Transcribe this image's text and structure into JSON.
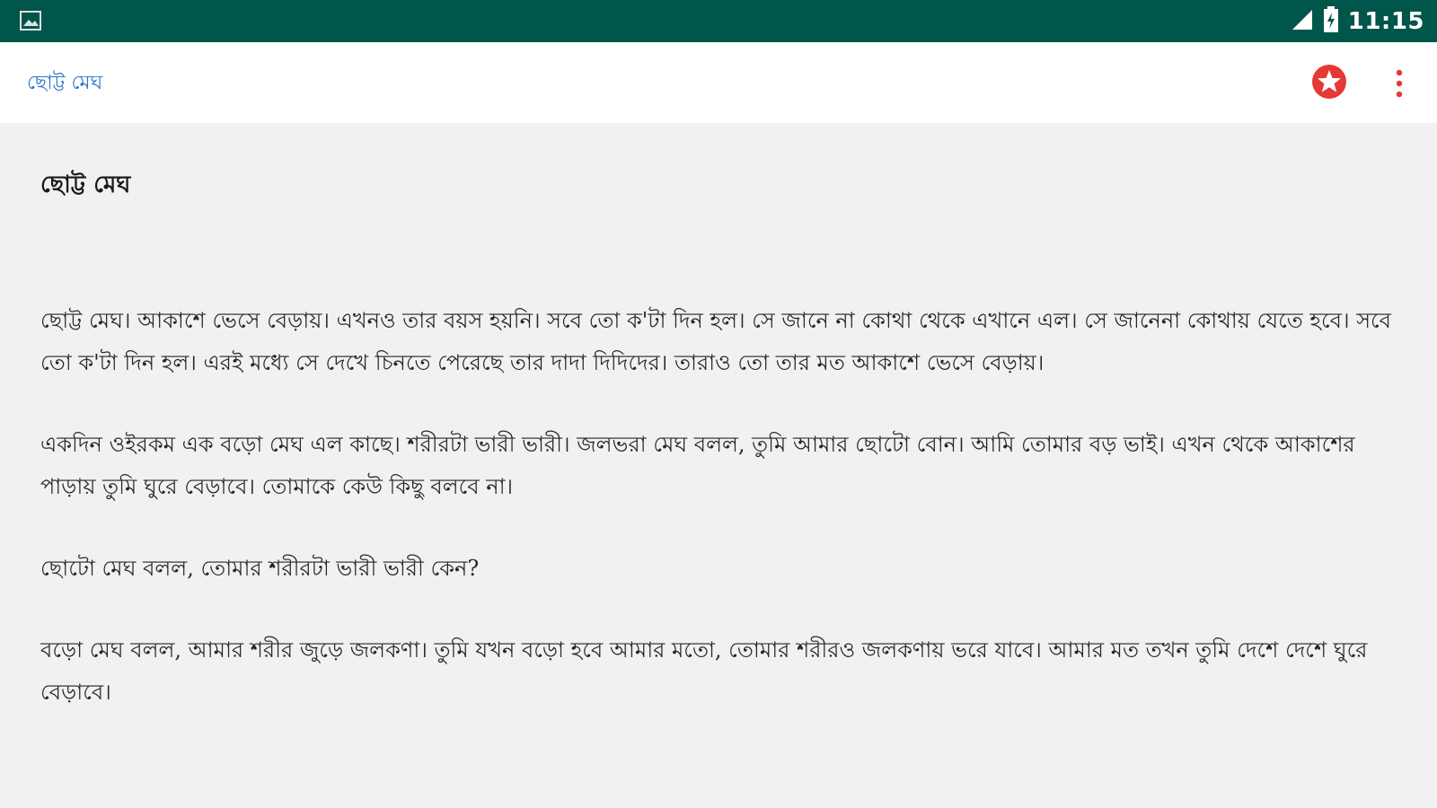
{
  "status_bar": {
    "time": "11:15",
    "icons": [
      "gallery-icon",
      "signal-icon",
      "battery-charging-icon"
    ]
  },
  "toolbar": {
    "title": "ছোট্ট মেঘ",
    "actions": [
      "favorite-star-icon",
      "more-vert-icon"
    ]
  },
  "article": {
    "heading": "ছোট্ট মেঘ",
    "paragraphs": [
      "ছোট্ট মেঘ। আকাশে ভেসে বেড়ায়। এখনও তার বয়স হয়নি। সবে তো ক'টা দিন হল। সে জানে না কোথা থেকে এখানে এল। সে জানেনা কোথায় যেতে হবে। সবে তো ক'টা দিন হল। এরই মধ্যে সে দেখে চিনতে পেরেছে তার দাদা দিদিদের। তারাও তো তার মত আকাশে ভেসে বেড়ায়।",
      "একদিন ওইরকম এক বড়ো মেঘ এল কাছে। শরীরটা ভারী ভারী। জলভরা মেঘ বলল, তুমি আমার ছোটো বোন। আমি তোমার বড় ভাই। এখন থেকে আকাশের পাড়ায় তুমি ঘুরে বেড়াবে। তোমাকে কেউ কিছু বলবে না।",
      "ছোটো মেঘ বলল, তোমার শরীরটা ভারী ভারী কেন?",
      "বড়ো মেঘ বলল, আমার শরীর জুড়ে জলকণা। তুমি যখন বড়ো হবে আমার মতো, তোমার শরীরও জলকণায় ভরে যাবে। আমার মত তখন তুমি দেশে দেশে ঘুরে বেড়াবে।"
    ]
  },
  "colors": {
    "status_bar": "#00564a",
    "toolbar_title": "#2a73cc",
    "accent_red": "#e53935",
    "background": "#f1f1f1"
  }
}
